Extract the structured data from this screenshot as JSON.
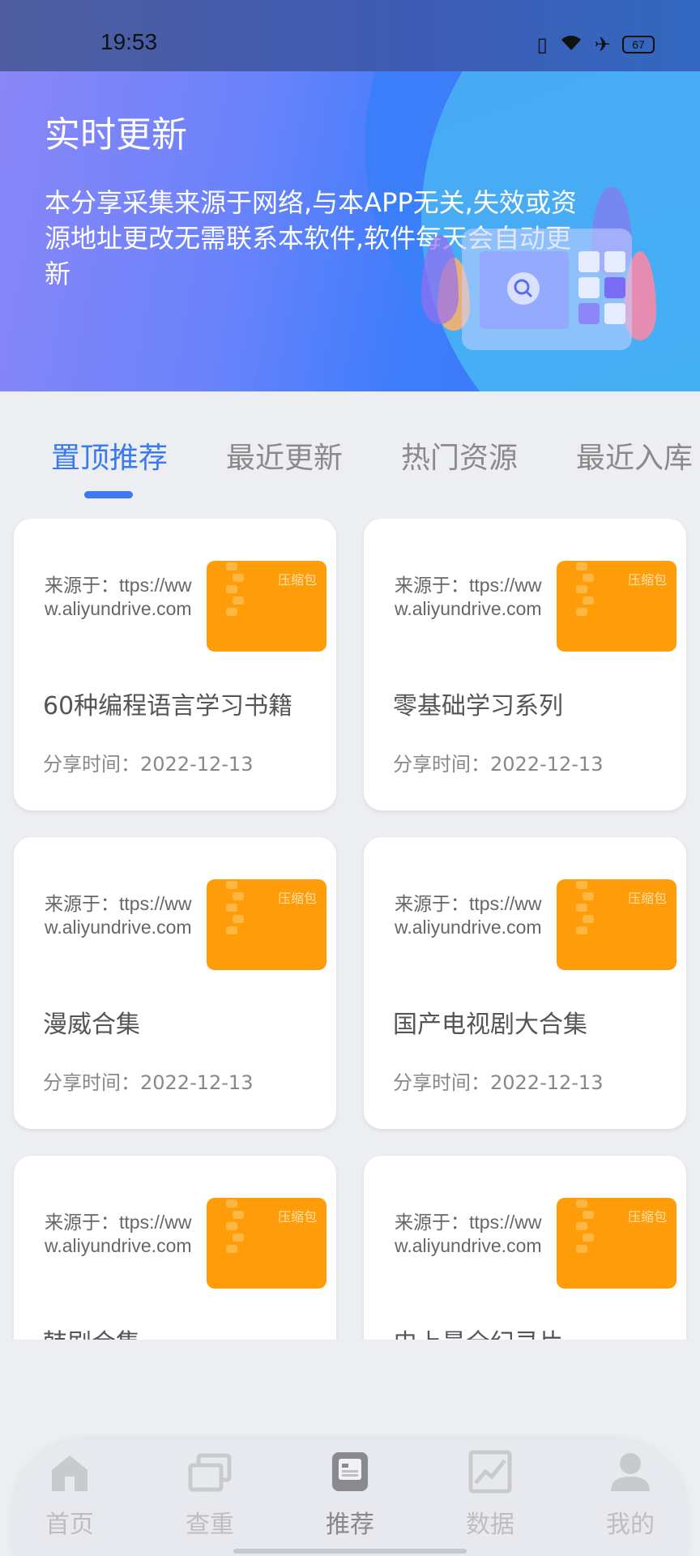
{
  "status_bar": {
    "time": "19:53",
    "battery": "67"
  },
  "header": {
    "title": "实时更新",
    "description": "本分享采集来源于网络,与本APP无关,失效或资源地址更改无需联系本软件,软件每天会自动更新"
  },
  "tabs": [
    {
      "label": "置顶推荐",
      "active": true
    },
    {
      "label": "最近更新",
      "active": false
    },
    {
      "label": "热门资源",
      "active": false
    },
    {
      "label": "最近入库",
      "active": false
    }
  ],
  "cards": [
    {
      "source_prefix": "来源于：",
      "source_url": "ttps://www.aliyundrive.com",
      "badge": "压缩包",
      "name": "60种编程语言学习书籍",
      "date": "分享时间：2022-12-13"
    },
    {
      "source_prefix": "来源于：",
      "source_url": "ttps://www.aliyundrive.com",
      "badge": "压缩包",
      "name": "零基础学习系列",
      "date": "分享时间：2022-12-13"
    },
    {
      "source_prefix": "来源于：",
      "source_url": "ttps://www.aliyundrive.com",
      "badge": "压缩包",
      "name": "漫威合集",
      "date": "分享时间：2022-12-13"
    },
    {
      "source_prefix": "来源于：",
      "source_url": "ttps://www.aliyundrive.com",
      "badge": "压缩包",
      "name": "国产电视剧大合集",
      "date": "分享时间：2022-12-13"
    },
    {
      "source_prefix": "来源于：",
      "source_url": "ttps://www.aliyundrive.com",
      "badge": "压缩包",
      "name": "韩剧合集",
      "date": ""
    },
    {
      "source_prefix": "来源于：",
      "source_url": "ttps://www.aliyundrive.com",
      "badge": "压缩包",
      "name": "史上最全纪录片",
      "date": ""
    }
  ],
  "nav": [
    {
      "label": "首页",
      "icon": "home-icon"
    },
    {
      "label": "查重",
      "icon": "duplicate-check-icon"
    },
    {
      "label": "推荐",
      "icon": "recommend-icon",
      "active": true
    },
    {
      "label": "数据",
      "icon": "chart-icon"
    },
    {
      "label": "我的",
      "icon": "profile-icon"
    }
  ],
  "colors": {
    "accent": "#3a7af0",
    "thumb": "#ff9c0a"
  }
}
